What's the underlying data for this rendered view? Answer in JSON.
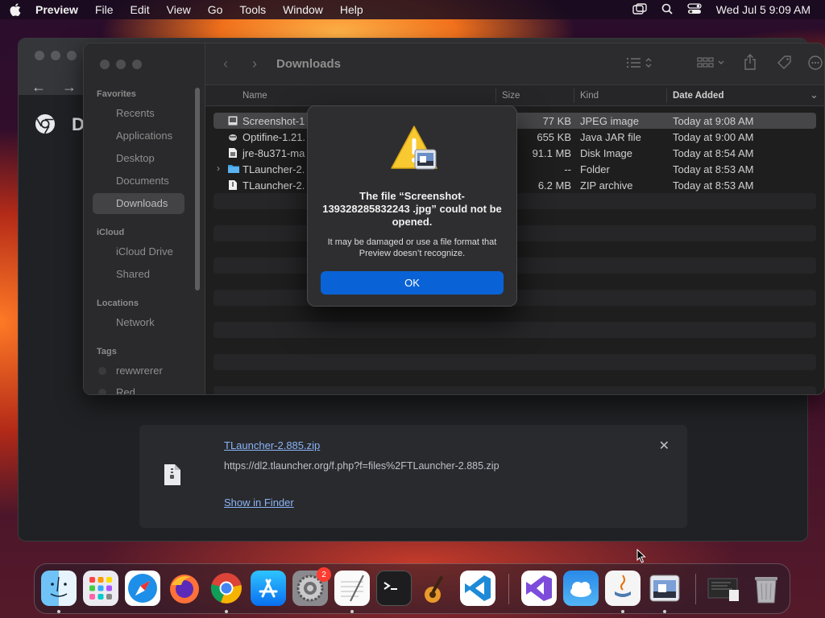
{
  "menubar": {
    "app": "Preview",
    "items": [
      "File",
      "Edit",
      "View",
      "Go",
      "Tools",
      "Window",
      "Help"
    ],
    "clock": "Wed Jul 5  9:09 AM"
  },
  "chrome": {
    "title_partial": "D",
    "download": {
      "file_name": "TLauncher-2.885.zip",
      "url": "https://dl2.tlauncher.org/f.php?f=files%2FTLauncher-2.885.zip",
      "show_in_finder": "Show in Finder"
    }
  },
  "finder": {
    "title": "Downloads",
    "sidebar": {
      "favorites_label": "Favorites",
      "favorites": [
        "Recents",
        "Applications",
        "Desktop",
        "Documents",
        "Downloads"
      ],
      "icloud_label": "iCloud",
      "icloud": [
        "iCloud Drive",
        "Shared"
      ],
      "locations_label": "Locations",
      "locations": [
        "Network"
      ],
      "tags_label": "Tags",
      "tags": [
        "rewwrerer",
        "Red"
      ]
    },
    "columns": {
      "name": "Name",
      "size": "Size",
      "kind": "Kind",
      "date": "Date Added"
    },
    "rows": [
      {
        "name": "Screenshot-1",
        "size": "77 KB",
        "kind": "JPEG image",
        "date": "Today at 9:08 AM"
      },
      {
        "name": "Optifine-1.21.",
        "size": "655 KB",
        "kind": "Java JAR file",
        "date": "Today at 9:00 AM"
      },
      {
        "name": "jre-8u371-ma",
        "size": "91.1 MB",
        "kind": "Disk Image",
        "date": "Today at 8:54 AM"
      },
      {
        "name": "TLauncher-2.",
        "size": "--",
        "kind": "Folder",
        "date": "Today at 8:53 AM"
      },
      {
        "name": "TLauncher-2.",
        "size": "6.2 MB",
        "kind": "ZIP archive",
        "date": "Today at 8:53 AM"
      }
    ]
  },
  "alert": {
    "title": "The file “Screenshot-139328285832243 .jpg” could not be opened.",
    "message": "It may be damaged or use a file format that Preview doesn’t recognize.",
    "ok": "OK"
  },
  "dock": {
    "settings_badge": "2",
    "apps": [
      "finder-icon",
      "launchpad-icon",
      "safari-icon",
      "firefox-icon",
      "chrome-icon",
      "app-store-icon",
      "system-settings-icon",
      "textedit-icon",
      "terminal-icon",
      "garageband-icon",
      "vscode-icon",
      "visual-studio-icon",
      "weather-icon",
      "java-icon",
      "preview-icon",
      "downloads-stack-icon",
      "trash-icon"
    ]
  }
}
